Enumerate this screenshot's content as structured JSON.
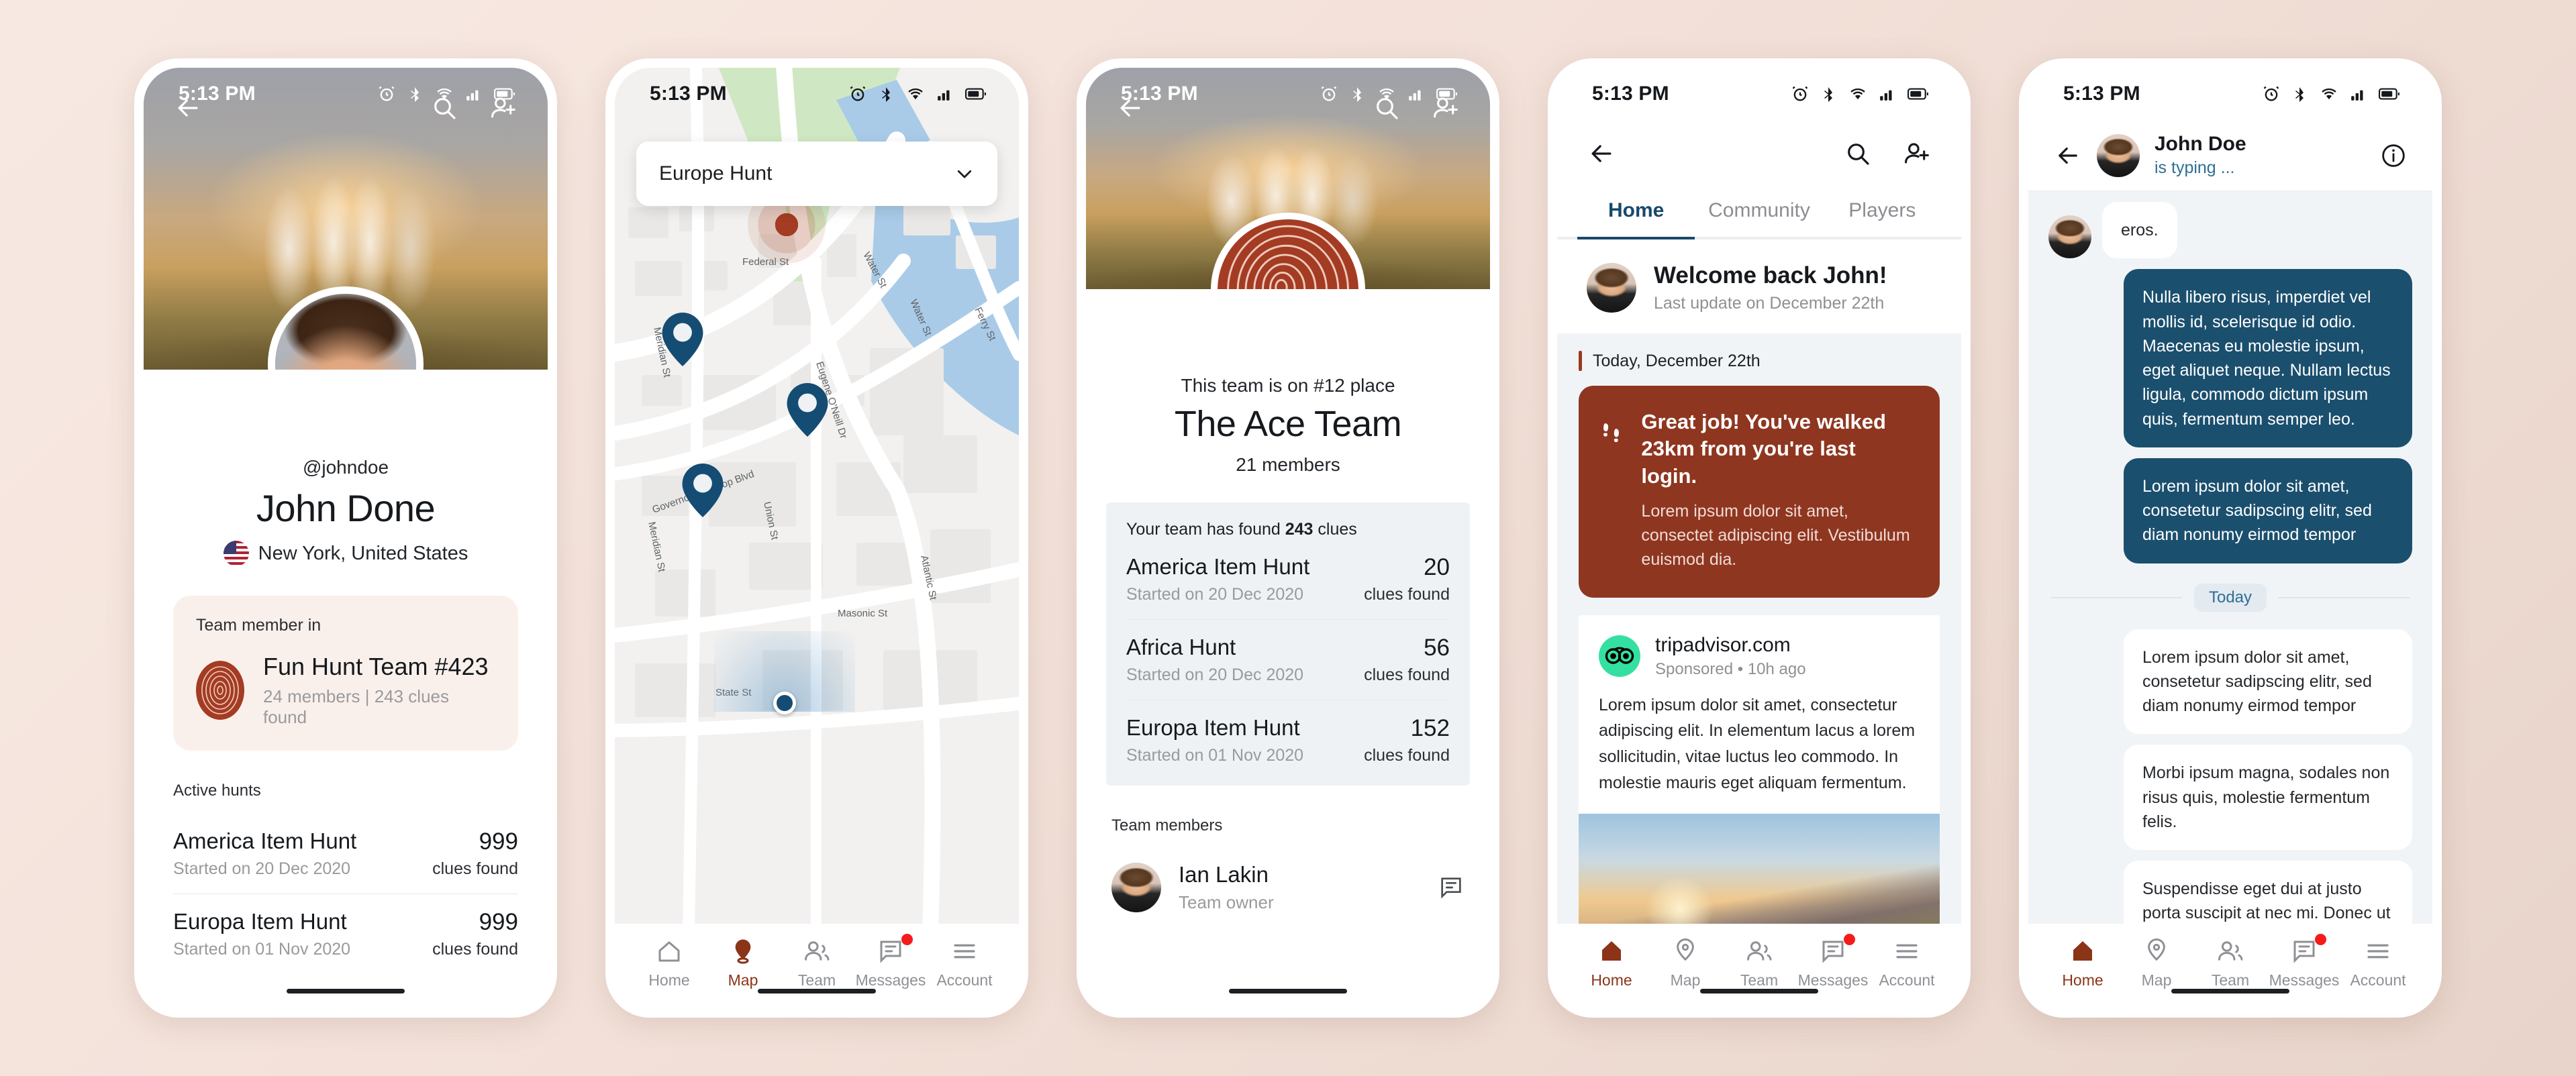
{
  "status_bar": {
    "time": "5:13 PM",
    "icons": [
      "alarm-icon",
      "bluetooth-icon",
      "wifi-icon",
      "signal-icon",
      "battery-icon"
    ]
  },
  "colors": {
    "brand_red": "#8f3620",
    "accent_blue": "#1b4f6e",
    "tab_active": "#17496b",
    "badge_red": "#f51b1b",
    "page_bg": "#f3e1d9"
  },
  "bottom_nav": {
    "items": [
      {
        "label": "Home",
        "icon": "home-icon"
      },
      {
        "label": "Map",
        "icon": "map-pin-icon"
      },
      {
        "label": "Team",
        "icon": "team-people-icon"
      },
      {
        "label": "Messages",
        "icon": "messages-icon",
        "badge": true
      },
      {
        "label": "Account",
        "icon": "hamburger-menu-icon"
      }
    ]
  },
  "screen_profile": {
    "appbar": {
      "back": "back-arrow-icon",
      "search": "search-icon",
      "add_user": "add-person-icon"
    },
    "handle": "@johndoe",
    "name": "John Done",
    "location": "New York, United States",
    "flag": "us-flag-icon",
    "team_card": {
      "label": "Team member in",
      "team_name": "Fun Hunt Team #423",
      "team_stats": "24 members | 243 clues found"
    },
    "active_hunts_label": "Active hunts",
    "hunts": [
      {
        "name": "America Item Hunt",
        "date": "Started on 20 Dec 2020",
        "count": "999",
        "unit": "clues found"
      },
      {
        "name": "Europa Item Hunt",
        "date": "Started on 01 Nov 2020",
        "count": "999",
        "unit": "clues found"
      }
    ]
  },
  "screen_map": {
    "selector": {
      "value": "Europe Hunt",
      "chevron": "chevron-down-icon"
    },
    "street_labels": [
      "Federal St",
      "Meridian St",
      "Water St",
      "Water St",
      "Ferry St",
      "Eugene O'Neill Dr",
      "Governor Winthrop Blvd",
      "Union St",
      "Masonic St",
      "Atlantic St",
      "State St",
      "Meridian St"
    ],
    "markers": {
      "clue_hotspot": 1,
      "pins": 3,
      "user_location": 1
    },
    "active_nav": "Map"
  },
  "screen_team": {
    "appbar": {
      "back": "back-arrow-icon",
      "search": "search-icon",
      "add_user": "add-person-icon"
    },
    "rank_line": "This team is on #12 place",
    "team_name": "The Ace Team",
    "members_count": "21 members",
    "clue_panel_title_pre": "Your team has found ",
    "clue_panel_title_bold": "243",
    "clue_panel_title_post": " clues",
    "hunts": [
      {
        "name": "America Item Hunt",
        "date": "Started on 20 Dec 2020",
        "count": "20",
        "unit": "clues found"
      },
      {
        "name": "Africa Hunt",
        "date": "Started on 20 Dec 2020",
        "count": "56",
        "unit": "clues found"
      },
      {
        "name": "Europa Item Hunt",
        "date": "Started on 01 Nov 2020",
        "count": "152",
        "unit": "clues found"
      }
    ],
    "members_label": "Team members",
    "members": [
      {
        "name": "Ian Lakin",
        "role": "Team owner",
        "action_icon": "message-icon"
      }
    ]
  },
  "screen_home": {
    "appbar": {
      "back": "back-arrow-icon",
      "search": "search-icon",
      "add_user": "add-person-icon"
    },
    "tabs": [
      {
        "label": "Home",
        "active": true
      },
      {
        "label": "Community",
        "active": false
      },
      {
        "label": "Players",
        "active": false
      }
    ],
    "welcome": {
      "title": "Welcome back John!",
      "subtitle": "Last update on December 22th"
    },
    "feed_date": "Today, December 22th",
    "walk_card": {
      "icon": "footsteps-icon",
      "title": "Great job! You've walked 23km from you're last login.",
      "body": "Lorem ipsum dolor sit amet, consectet adipiscing elit. Vestibulum euismod dia."
    },
    "ad_card": {
      "logo": "tripadvisor-owl-icon",
      "domain": "tripadvisor.com",
      "meta": "Sponsored • 10h ago",
      "body": "Lorem ipsum dolor sit amet, consectetur adipiscing elit. In elementum lacus a lorem sollicitudin, vitae luctus leo commodo. In molestie mauris eget aliquam fermentum.",
      "photo": "mountain-sunrise-photo"
    },
    "active_nav": "Home"
  },
  "screen_chat": {
    "appbar": {
      "back": "back-arrow-icon",
      "info": "info-icon"
    },
    "contact_name": "John Doe",
    "contact_status": "is typing ...",
    "messages": [
      {
        "from": "them",
        "text": "eros.",
        "avatar": true
      },
      {
        "from": "me",
        "text": "Nulla libero risus, imperdiet vel mollis id, scelerisque id odio. Maecenas eu molestie ipsum, eget aliquet neque. Nullam lectus ligula, commodo dictum ipsum quis, fermentum semper leo."
      },
      {
        "from": "me",
        "text": "Lorem ipsum dolor sit amet, consetetur sadipscing elitr, sed diam nonumy eirmod tempor"
      }
    ],
    "day_separator": "Today",
    "messages_today": [
      {
        "from": "them",
        "text": "Lorem ipsum dolor sit amet, consetetur sadipscing elitr, sed diam nonumy eirmod tempor"
      },
      {
        "from": "them",
        "text": "Morbi ipsum magna, sodales non risus quis, molestie fermentum felis."
      },
      {
        "from": "them",
        "text": "Suspendisse eget dui at justo porta suscipit at nec mi. Donec ut nunc dui."
      }
    ],
    "typing_indicator": "typing-dots-icon",
    "active_nav": "Home"
  }
}
